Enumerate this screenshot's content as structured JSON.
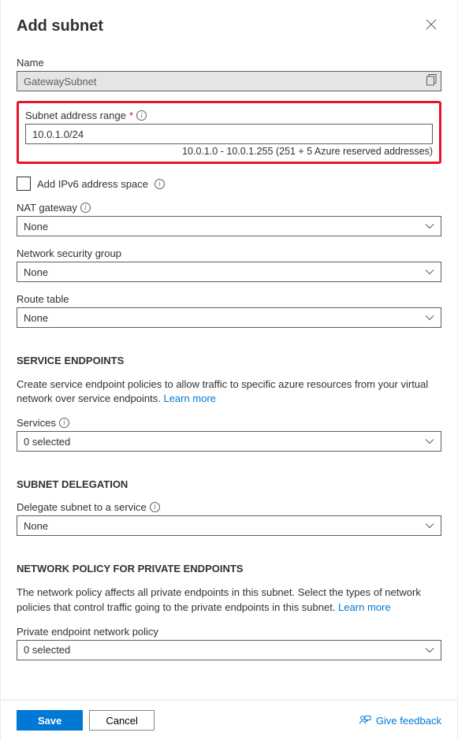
{
  "header": {
    "title": "Add subnet"
  },
  "name": {
    "label": "Name",
    "value": "GatewaySubnet"
  },
  "subnet_range": {
    "label": "Subnet address range",
    "value": "10.0.1.0/24",
    "hint": "10.0.1.0 - 10.0.1.255 (251 + 5 Azure reserved addresses)"
  },
  "ipv6": {
    "label": "Add IPv6 address space"
  },
  "nat_gateway": {
    "label": "NAT gateway",
    "value": "None"
  },
  "nsg": {
    "label": "Network security group",
    "value": "None"
  },
  "route_table": {
    "label": "Route table",
    "value": "None"
  },
  "service_endpoints": {
    "title": "SERVICE ENDPOINTS",
    "desc": "Create service endpoint policies to allow traffic to specific azure resources from your virtual network over service endpoints.",
    "learn_more": "Learn more",
    "services_label": "Services",
    "services_value": "0 selected"
  },
  "subnet_delegation": {
    "title": "SUBNET DELEGATION",
    "label": "Delegate subnet to a service",
    "value": "None"
  },
  "network_policy": {
    "title": "NETWORK POLICY FOR PRIVATE ENDPOINTS",
    "desc": "The network policy affects all private endpoints in this subnet. Select the types of network policies that control traffic going to the private endpoints in this subnet.",
    "learn_more": "Learn more",
    "label": "Private endpoint network policy",
    "value": "0 selected"
  },
  "footer": {
    "save": "Save",
    "cancel": "Cancel",
    "feedback": "Give feedback"
  }
}
